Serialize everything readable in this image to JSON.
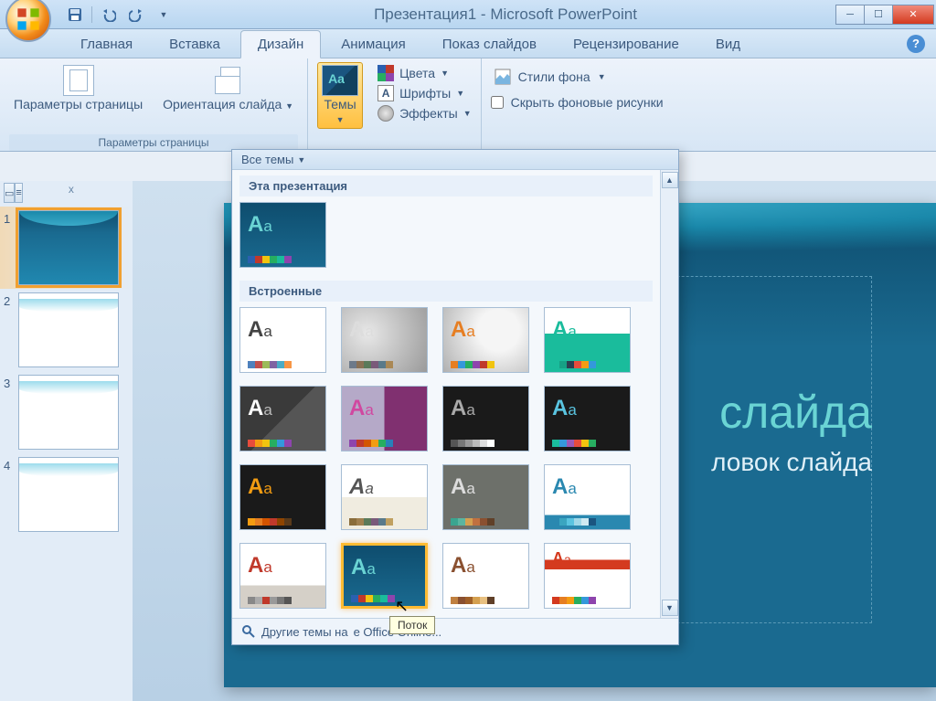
{
  "titlebar": {
    "title": "Презентация1 - Microsoft PowerPoint"
  },
  "tabs": {
    "home": "Главная",
    "insert": "Вставка",
    "design": "Дизайн",
    "animation": "Анимация",
    "slideshow": "Показ слайдов",
    "review": "Рецензирование",
    "view": "Вид"
  },
  "ribbon": {
    "page_setup_group": "Параметры страницы",
    "page_setup": "Параметры страницы",
    "orientation": "Ориентация слайда",
    "themes": "Темы",
    "colors": "Цвета",
    "fonts": "Шрифты",
    "effects": "Эффекты",
    "bg_styles": "Стили фона",
    "hide_bg": "Скрыть фоновые рисунки"
  },
  "gallery": {
    "all_themes": "Все темы",
    "this_pres": "Эта презентация",
    "builtin": "Встроенные",
    "more_online": "Другие темы на",
    "more_online_suffix": "e Office Online...",
    "tooltip": "Поток"
  },
  "thumbs": [
    {
      "num": "1"
    },
    {
      "num": "2"
    },
    {
      "num": "3"
    },
    {
      "num": "4"
    }
  ],
  "slide": {
    "title_fragment": "слайда",
    "subtitle_fragment": "ловок слайда"
  }
}
